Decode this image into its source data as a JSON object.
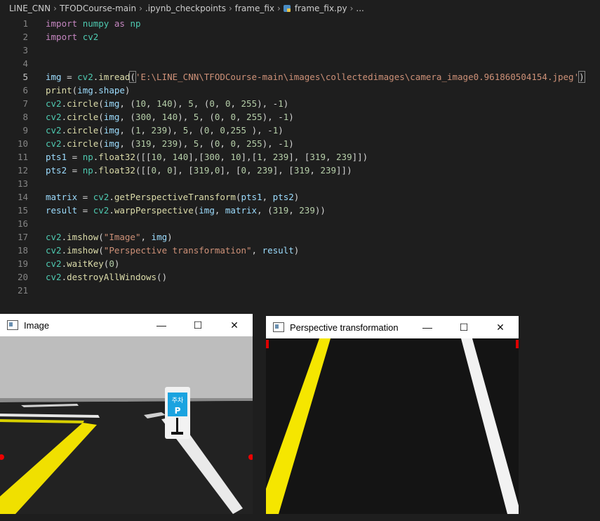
{
  "breadcrumb": [
    "LINE_CNN",
    "TFODCourse-main",
    ".ipynb_checkpoints",
    "frame_fix",
    "frame_fix.py",
    "..."
  ],
  "code": {
    "line_numbers": [
      "1",
      "2",
      "3",
      "4",
      "5",
      "6",
      "7",
      "8",
      "9",
      "10",
      "11",
      "12",
      "13",
      "14",
      "15",
      "16",
      "17",
      "18",
      "19",
      "20",
      "21"
    ],
    "active_line": 5
  },
  "windows": {
    "image": {
      "title": "Image"
    },
    "perspective": {
      "title": "Perspective transformation"
    },
    "controls": {
      "minimize": "—",
      "maximize": "☐",
      "close": "✕"
    }
  },
  "sign": {
    "text_top": "주차",
    "text_bottom": "P"
  },
  "colors": {
    "editor_bg": "#1e1e1e",
    "keyword": "#c586c0",
    "function": "#dcdcaa",
    "string": "#ce9178",
    "number": "#b5cea8",
    "variable": "#9cdcfe"
  }
}
